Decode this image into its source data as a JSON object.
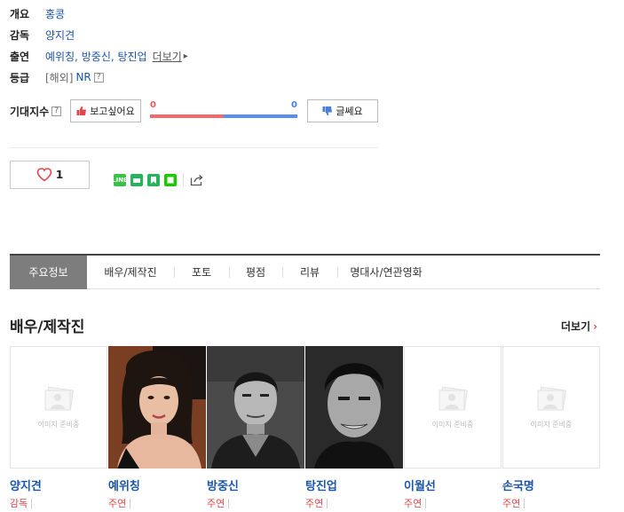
{
  "info": {
    "overview_label": "개요",
    "overview_value": "홍콩",
    "director_label": "감독",
    "director_value": "양지견",
    "cast_label": "출연",
    "cast_value": "예위칭, 방중신, 탕진업",
    "cast_more": "더보기",
    "rating_label": "등급",
    "rating_prefix": "[해외]",
    "rating_value": "NR"
  },
  "expectation": {
    "label": "기대지수",
    "want_button": "보고싶어요",
    "meh_button": "글쎄요",
    "want_count": "0",
    "meh_count": "0",
    "want_share": 0.5
  },
  "like": {
    "count": "1"
  },
  "share_icons": [
    "line-icon",
    "band-icon",
    "bookmark-icon",
    "naver-icon",
    "share-icon"
  ],
  "tabs": [
    {
      "label": "주요정보",
      "active": true
    },
    {
      "label": "배우/제작진"
    },
    {
      "label": "포토"
    },
    {
      "label": "평점"
    },
    {
      "label": "리뷰"
    },
    {
      "label": "명대사/연관영화"
    }
  ],
  "cast_section": {
    "title": "배우/제작진",
    "more": "더보기",
    "placeholder_text": "이미지 준비중",
    "people": [
      {
        "name": "양지견",
        "role": "감독"
      },
      {
        "name": "예위칭",
        "role": "주연"
      },
      {
        "name": "방중신",
        "role": "주연"
      },
      {
        "name": "탕진업",
        "role": "주연"
      },
      {
        "name": "이월선",
        "role": "주연"
      },
      {
        "name": "손국명",
        "role": "주연"
      }
    ]
  },
  "colors": {
    "link_blue": "#1a55a8",
    "role_red": "#e0474a",
    "bar_red": "#f06a6a",
    "bar_blue": "#5b8def",
    "active_tab": "#7d7d7d"
  }
}
